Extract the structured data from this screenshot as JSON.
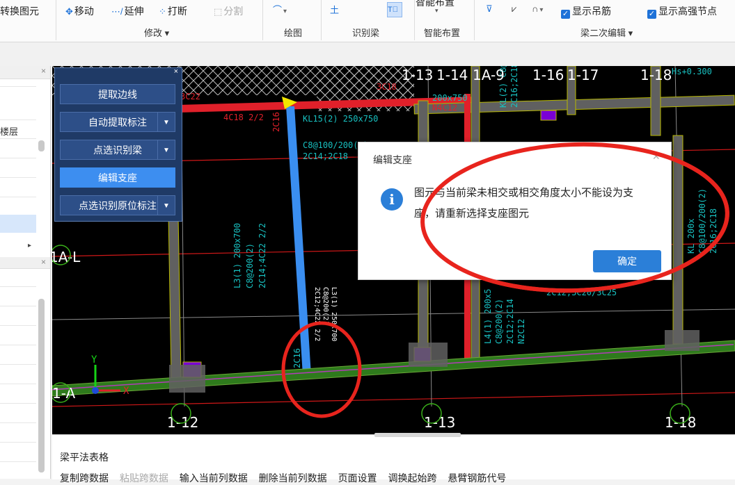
{
  "ribbon": {
    "convert_label": "转换图元",
    "move_label": "移动",
    "extend_label": "延伸",
    "break_label": "打断",
    "split_label": "分割",
    "modify_group": "修改",
    "draw_group": "绘图",
    "identify_group": "识别梁",
    "smart_layout_label": "智能布置",
    "smart_layout_group": "智能布置",
    "show_hanger_label": "显示吊筋",
    "show_high_strength_label": "显示高强节点",
    "beam_secondary_group": "梁二次编辑"
  },
  "left_panel": {
    "floor_col_label": "楼层"
  },
  "tool_panel": {
    "buttons": [
      "提取边线",
      "自动提取标注",
      "点选识别梁",
      "编辑支座",
      "点选识别原位标注"
    ],
    "active_index": 3
  },
  "cad": {
    "axis_labels": [
      "1-13",
      "1-14",
      "1A-9",
      "1-16",
      "1-17",
      "1-18",
      "1A-L",
      "1-A",
      "1-12",
      "1-13",
      "1-18"
    ],
    "annotations": [
      "KL15(2) 250x750",
      "C8@100/200(2)",
      "2C14;2C18",
      "4C18 2/2",
      "3C18",
      "3C22",
      "2C16",
      "L3(1) 200x700",
      "C8@200(2)",
      "2C14;4C22 2/2",
      "200x750",
      "N4C12",
      "KL(2) C8@100/200(2)",
      "2C16;2C18",
      "L4(1) 200x5",
      "C8@200(2)",
      "2C12;2C14",
      "N2C12",
      "L3(1) 250x700",
      "C8@200(2)",
      "2C12;4C22 2/2",
      "2C16",
      "KL 200x",
      "C8@100/200(2)",
      "2C16;2C18",
      "2C12;3C20/3C25",
      "Hs+0.300"
    ],
    "ucs_x": "X",
    "ucs_y": "Y"
  },
  "dialog": {
    "title": "编辑支座",
    "message": "图元与当前梁未相交或相交角度太小不能设为支座，请重新选择支座图元",
    "ok_label": "确定"
  },
  "bottom": {
    "title": "梁平法表格",
    "toolbar": [
      "复制跨数据",
      "粘贴跨数据",
      "输入当前列数据",
      "删除当前列数据",
      "页面设置",
      "调换起始跨",
      "悬臂钢筋代号"
    ],
    "disabled_index": 1
  },
  "colors": {
    "accent": "#2b7fd8",
    "canvas_bg": "#000000",
    "annotation_red": "#e0202a"
  }
}
